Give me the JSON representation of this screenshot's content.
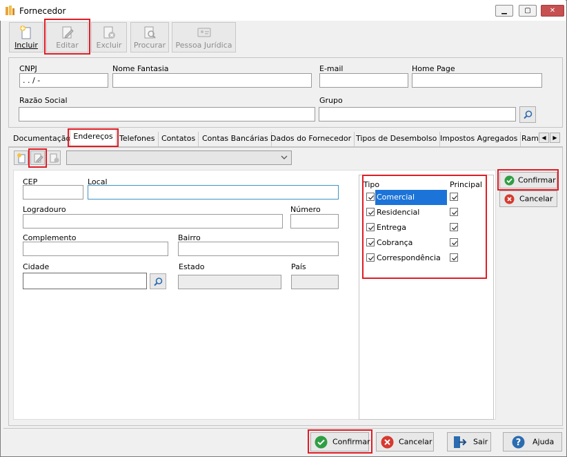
{
  "window": {
    "title": "Fornecedor",
    "minimize": "▁",
    "maximize": "▢",
    "close": "✕"
  },
  "toolbar": {
    "incluir": "Incluir",
    "editar": "Editar",
    "excluir": "Excluir",
    "procurar": "Procurar",
    "pessoa_juridica": "Pessoa Jurídica"
  },
  "header": {
    "cnpj_label": "CNPJ",
    "cnpj_value": " .  .  /    -",
    "nome_fantasia_label": "Nome Fantasia",
    "nome_fantasia_value": "",
    "email_label": "E-mail",
    "email_value": "",
    "home_page_label": "Home Page",
    "home_page_value": "",
    "razao_social_label": "Razão Social",
    "razao_social_value": "",
    "grupo_label": "Grupo",
    "grupo_value": ""
  },
  "tabs": [
    "Documentação",
    "Endereços",
    "Telefones",
    "Contatos",
    "Contas Bancárias",
    "Dados do Fornecedor",
    "Tipos de Desembolso",
    "Impostos Agregados",
    "Ramo"
  ],
  "tab_arrows": {
    "left": "◀",
    "right": "▶"
  },
  "address": {
    "cep_label": "CEP",
    "cep_value": "",
    "local_label": "Local",
    "local_value": "",
    "logradouro_label": "Logradouro",
    "logradouro_value": "",
    "numero_label": "Número",
    "numero_value": "",
    "complemento_label": "Complemento",
    "complemento_value": "",
    "bairro_label": "Bairro",
    "bairro_value": "",
    "cidade_label": "Cidade",
    "cidade_value": "",
    "estado_label": "Estado",
    "estado_value": "",
    "pais_label": "País",
    "pais_value": ""
  },
  "types": {
    "tipo_header": "Tipo",
    "principal_header": "Principal",
    "items": [
      {
        "label": "Comercial",
        "checked": true,
        "principal": true,
        "selected": true
      },
      {
        "label": "Residencial",
        "checked": true,
        "principal": true,
        "selected": false
      },
      {
        "label": "Entrega",
        "checked": true,
        "principal": true,
        "selected": false
      },
      {
        "label": "Cobrança",
        "checked": true,
        "principal": true,
        "selected": false
      },
      {
        "label": "Correspondência",
        "checked": true,
        "principal": true,
        "selected": false
      }
    ]
  },
  "side_buttons": {
    "confirmar": "Confirmar",
    "cancelar": "Cancelar"
  },
  "footer": {
    "confirmar": "Confirmar",
    "cancelar": "Cancelar",
    "sair": "Sair",
    "ajuda": "Ajuda"
  },
  "colors": {
    "highlight": "#e01b24",
    "selection": "#1c74d9",
    "confirm_green": "#2f9e44",
    "cancel_red": "#d63a2f",
    "help_blue": "#2b6cb0"
  }
}
